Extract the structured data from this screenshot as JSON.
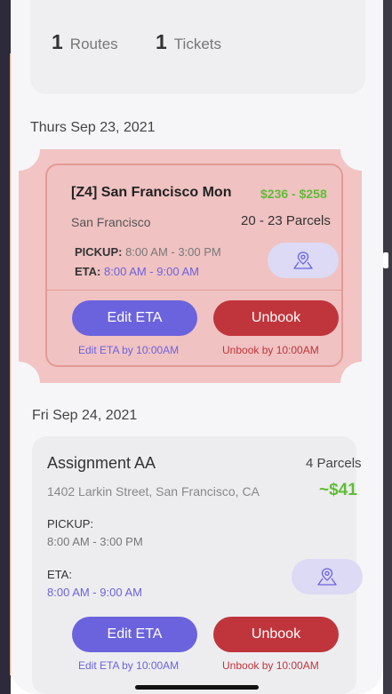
{
  "summary": {
    "routes_count": "1",
    "routes_label": "Routes",
    "tickets_count": "1",
    "tickets_label": "Tickets"
  },
  "sections": [
    {
      "date": "Thurs Sep 23, 2021",
      "ticket": {
        "title": "[Z4] San Francisco Mon",
        "price": "$236 - $258",
        "city": "San Francisco",
        "parcels": "20 - 23 Parcels",
        "pickup_label": "PICKUP:",
        "pickup_time": "8:00 AM - 3:00 PM",
        "eta_label": "ETA:",
        "eta_time": "8:00 AM - 9:00 AM",
        "map_icon": "map-pin-icon",
        "edit_button": "Edit ETA",
        "unbook_button": "Unbook",
        "edit_hint": "Edit ETA by 10:00AM",
        "unbook_hint": "Unbook by 10:00AM"
      }
    },
    {
      "date": "Fri Sep 24, 2021",
      "assignment": {
        "title": "Assignment AA",
        "parcels": "4 Parcels",
        "address": "1402 Larkin Street, San Francisco, CA",
        "price": "~$41",
        "pickup_label": "PICKUP:",
        "pickup_time": "8:00 AM - 3:00 PM",
        "eta_label": "ETA:",
        "eta_time": "8:00 AM - 9:00 AM",
        "map_icon": "map-pin-icon",
        "edit_button": "Edit ETA",
        "unbook_button": "Unbook",
        "edit_hint": "Edit ETA by 10:00AM",
        "unbook_hint": "Unbook by 10:00AM"
      }
    }
  ],
  "colors": {
    "accent_purple": "#6b63dd",
    "danger_red": "#c0353c",
    "price_green": "#5fbd35",
    "ticket_pink": "#f2c4c4"
  }
}
